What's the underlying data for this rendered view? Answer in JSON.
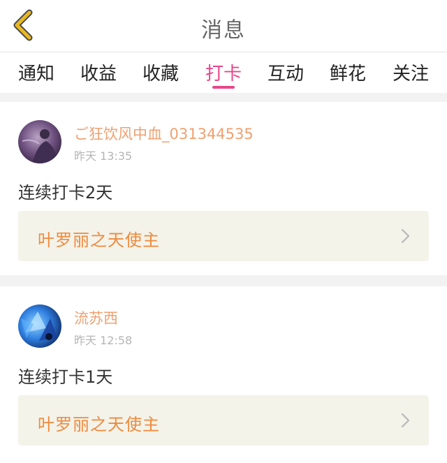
{
  "header": {
    "title": "消息",
    "back_icon": "chevron-left-icon",
    "back_color": "#e8b820"
  },
  "tabs": [
    {
      "label": "通知",
      "active": false
    },
    {
      "label": "收益",
      "active": false
    },
    {
      "label": "收藏",
      "active": false
    },
    {
      "label": "打卡",
      "active": true
    },
    {
      "label": "互动",
      "active": false
    },
    {
      "label": "鲜花",
      "active": false
    },
    {
      "label": "关注",
      "active": false
    }
  ],
  "accent_color": "#e8478a",
  "notifications": [
    {
      "username": "ご狂饮风中血_031344535",
      "time": "昨天 13:35",
      "message": "连续打卡2天",
      "book": "叶罗丽之天使主"
    },
    {
      "username": "流苏西",
      "time": "昨天 12:58",
      "message": "连续打卡1天",
      "book": "叶罗丽之天使主"
    }
  ]
}
